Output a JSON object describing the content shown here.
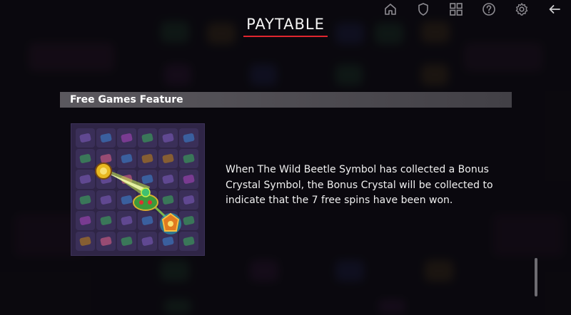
{
  "topbar": {
    "icons": [
      "home-icon",
      "shield-icon",
      "grid-icon",
      "help-icon",
      "settings-icon",
      "back-arrow-icon"
    ]
  },
  "title": "PAYTABLE",
  "section": {
    "title": "Free Games Feature",
    "description": "When The Wild Beetle Symbol has collected a Bonus Crystal Symbol, the Bonus Crystal will be collected to indicate that the 7 free spins have been won."
  },
  "colors": {
    "accent": "#e0262f",
    "section_bar": "#69666c",
    "panel_bg": "#2f2546",
    "beam": "#c8f04a"
  }
}
